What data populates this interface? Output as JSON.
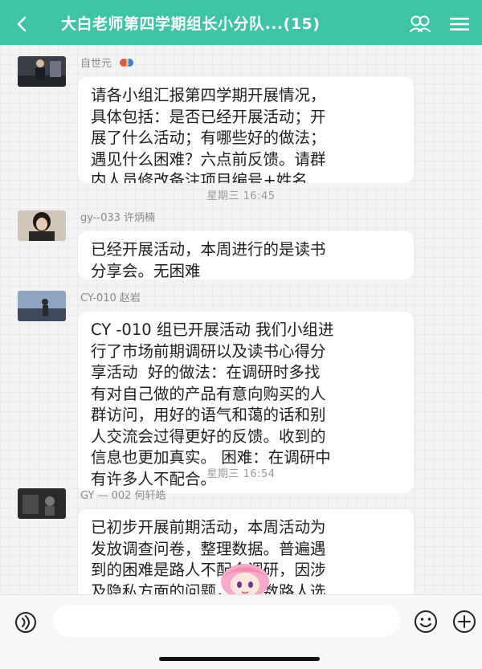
{
  "header": {
    "title": "大白老师第四学期组长小分队...(15)",
    "back_icon": "chevron-left-icon",
    "group_icon": "group-members-icon",
    "menu_icon": "hamburger-menu-icon",
    "bar_color": "#3fc3a7"
  },
  "messages": [
    {
      "sender": "自世元",
      "sender_badge_icon": "emoji-badge-icon",
      "text": "请各小组汇报第四学期开展情况，\n具体包括：是否已经开展活动；开\n展了什么活动；有哪些好的做法；\n遇见什么困难？六点前反馈。请群\n内人员修改备注项目编号+姓名"
    },
    {
      "time": "星期三 16:45",
      "sender": "gy--033 许炳楠",
      "text": "已经开展活动，本周进行的是读书\n分享会。无困难"
    },
    {
      "sender": "CY-010 赵岩",
      "text": "CY -010 组已开展活动 我们小组进\n行了市场前期调研以及读书心得分\n享活动  好的做法：在调研时多找\n有对自己做的产品有意向购买的人\n群访问，用好的语气和蔼的话和别\n人交流会过得更好的反馈。收到的\n信息也更加真实。 困难：在调研中\n有许多人不配合。"
    },
    {
      "time": "星期三 16:54",
      "sender": "GY — 002 何轩皓",
      "text": "已初步开展前期活动，本周活动为\n发放调查问卷，整理数据。普遍遇\n到的困难是路人不配合调研，因涉\n及隐私方面的问题，大多数路人选\n择拒绝。还一些群人为这方"
    }
  ],
  "input": {
    "placeholder": "",
    "value": ""
  },
  "bottom_icons": {
    "voice": "voice-icon",
    "emoji": "emoji-icon",
    "plus": "plus-icon"
  },
  "overlay": {
    "sticker_icon": "anime-girl-sticker-icon"
  }
}
